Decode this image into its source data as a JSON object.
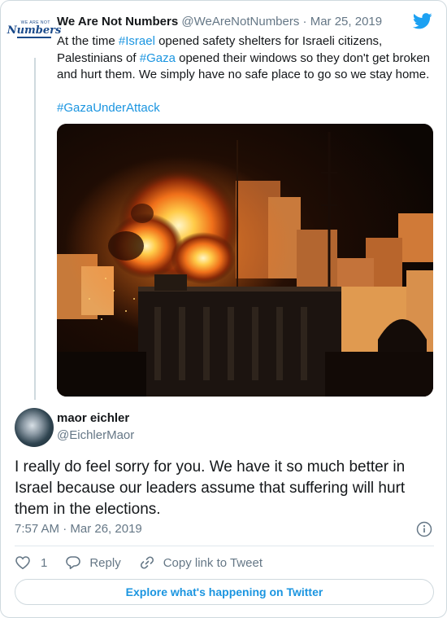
{
  "parent_tweet": {
    "display_name": "We Are Not Numbers",
    "handle": "@WeAreNotNumbers",
    "separator": "·",
    "date": "Mar 25, 2019",
    "avatar_logo_small": "WE ARE NOT",
    "avatar_logo_script": "Numbers",
    "text_before_tag1": "At the time ",
    "tag1": "#Israel",
    "text_between": " opened safety shelters for Israeli citizens, Palestinians of ",
    "tag2": "#Gaza",
    "text_after": " opened their windows so they don't get broken and hurt them. We simply have no safe place to go so we stay home.",
    "hashtag_line": "#GazaUnderAttack",
    "media_icon": "night-explosion-photo"
  },
  "reply_tweet": {
    "display_name": "maor eichler",
    "handle": "@EichlerMaor",
    "text": "I really do feel sorry for you. We have it so much better in Israel because our leaders assume that suffering will hurt them in the elections.",
    "timestamp": "7:57 AM · Mar 26, 2019"
  },
  "actions": {
    "like_count": "1",
    "reply_label": "Reply",
    "copy_link_label": "Copy link to Tweet"
  },
  "footer": {
    "explore_label": "Explore what's happening on Twitter"
  },
  "colors": {
    "link_blue": "#1b95e0",
    "twitter_blue": "#1da1f2",
    "muted_text": "#657786"
  }
}
